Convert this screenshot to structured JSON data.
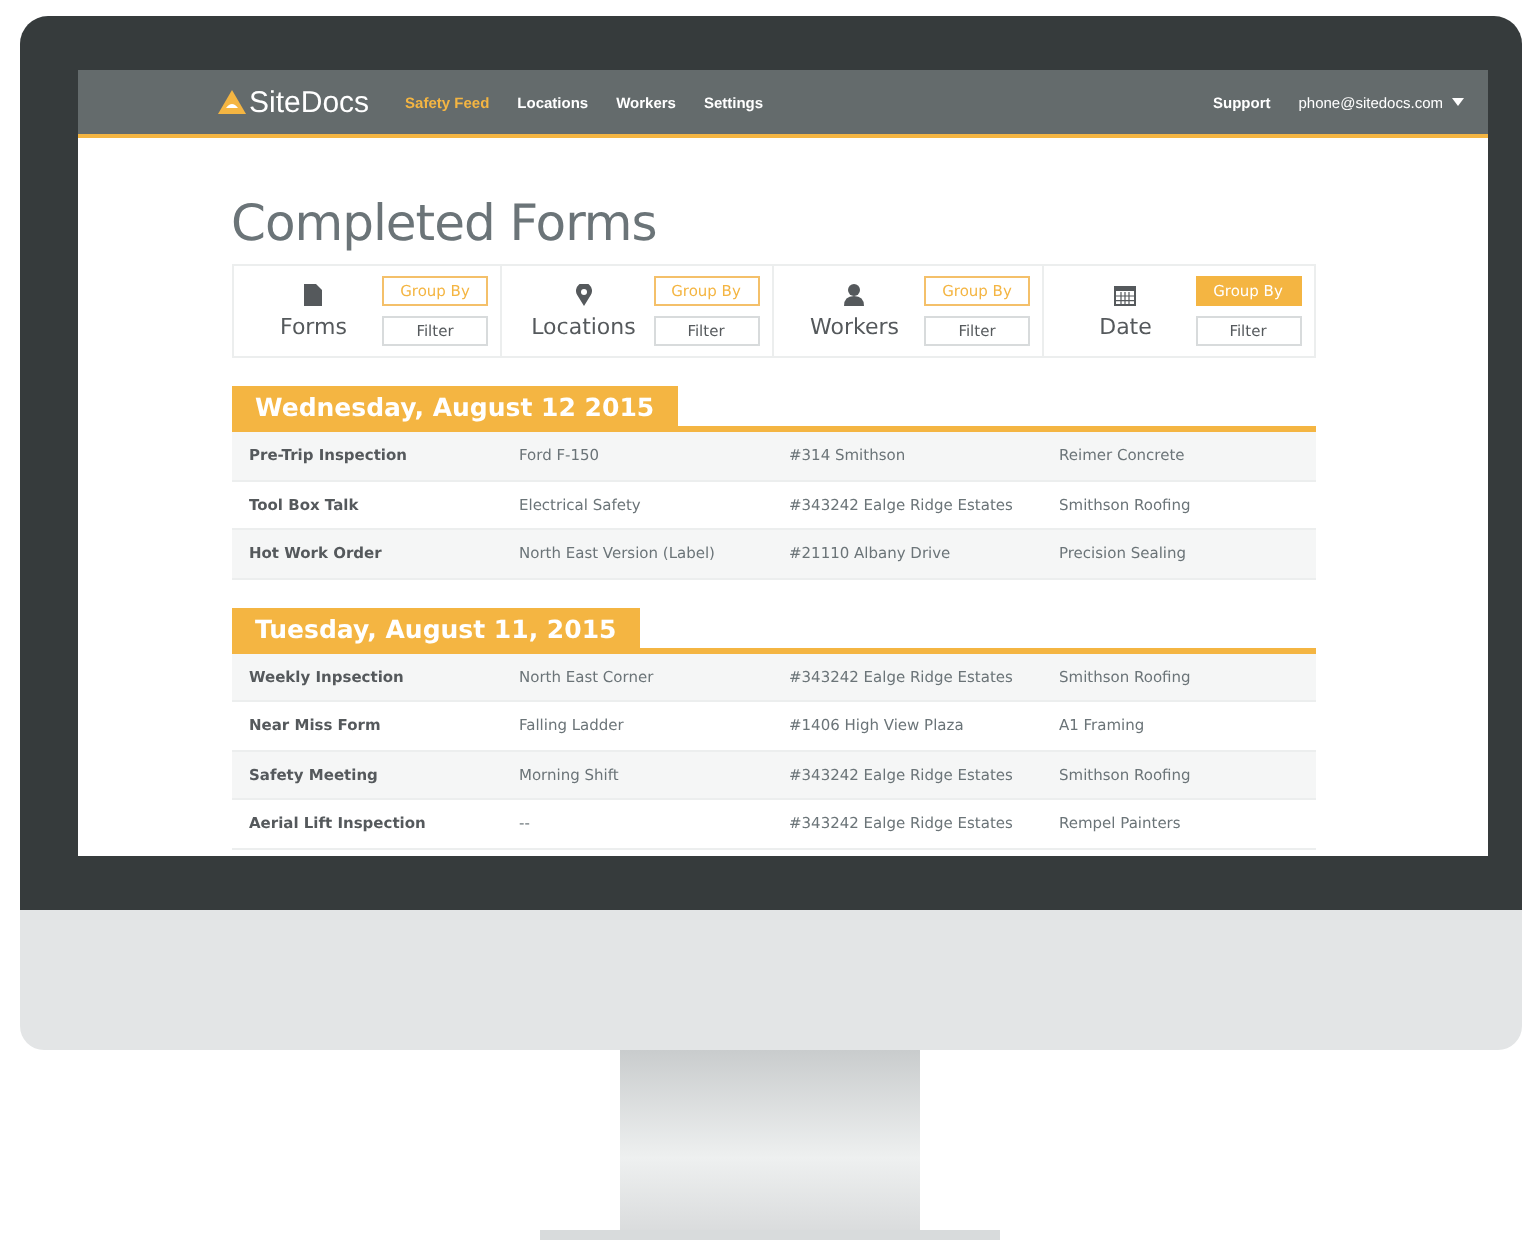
{
  "navbar": {
    "logo": {
      "site": "Site",
      "docs": "Docs"
    },
    "items": [
      {
        "label": "Safety Feed",
        "selected": true
      },
      {
        "label": "Locations",
        "selected": false
      },
      {
        "label": "Workers",
        "selected": false
      },
      {
        "label": "Settings",
        "selected": false
      }
    ],
    "support": "Support",
    "account": "phone@sitedocs.com"
  },
  "page_title": "Completed Forms",
  "filter_cards": [
    {
      "kind": "document",
      "label": "Forms",
      "group_by": {
        "label": "Group By",
        "selected": false
      },
      "filter": "Filter"
    },
    {
      "kind": "pin",
      "label": "Locations",
      "group_by": {
        "label": "Group By",
        "selected": false
      },
      "filter": "Filter"
    },
    {
      "kind": "person",
      "label": "Workers",
      "group_by": {
        "label": "Group By",
        "selected": false
      },
      "filter": "Filter"
    },
    {
      "kind": "calendar",
      "label": "Date",
      "group_by": {
        "label": "Group By",
        "selected": true
      },
      "filter": "Filter"
    }
  ],
  "groups": [
    {
      "heading": "Wednesday, August 12 2015",
      "rows": [
        [
          "Pre-Trip Inspection",
          "Ford F-150",
          "#314 Smithson",
          "Reimer Concrete"
        ],
        [
          "Tool Box Talk",
          "Electrical Safety",
          "#343242 Ealge Ridge Estates",
          "Smithson Roofing"
        ],
        [
          "Hot Work Order",
          "North East Version (Label)",
          "#21110 Albany Drive",
          "Precision Sealing"
        ]
      ]
    },
    {
      "heading": "Tuesday, August 11, 2015",
      "rows": [
        [
          "Weekly Inpsection",
          "North East Corner",
          "#343242 Ealge Ridge Estates",
          "Smithson Roofing"
        ],
        [
          "Near Miss Form",
          "Falling Ladder",
          "#1406 High View Plaza",
          "A1 Framing"
        ],
        [
          "Safety Meeting",
          "Morning Shift",
          "#343242 Ealge Ridge Estates",
          "Smithson Roofing"
        ],
        [
          "Aerial Lift Inspection",
          "--",
          "#343242 Ealge Ridge Estates",
          "Rempel Painters"
        ]
      ]
    }
  ]
}
